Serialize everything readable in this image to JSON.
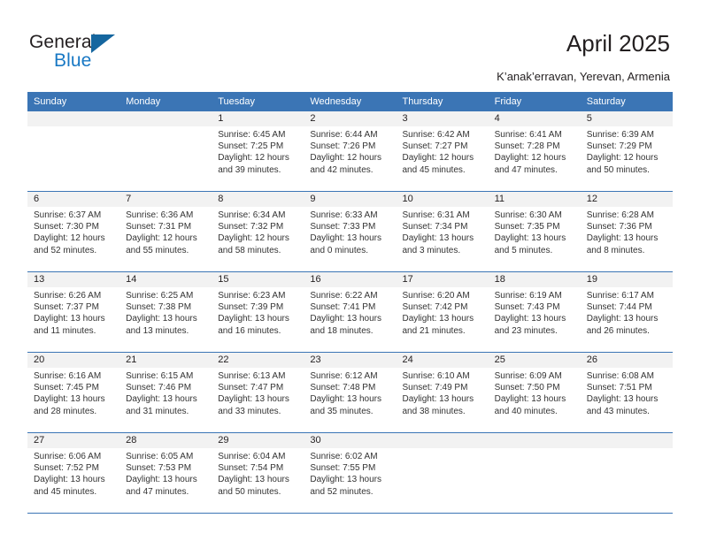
{
  "brand": {
    "name_part1": "General",
    "name_part2": "Blue"
  },
  "header": {
    "title": "April 2025",
    "location": "K’anak’erravan, Yerevan, Armenia"
  },
  "colors": {
    "header_blue": "#3b75b5",
    "brand_blue": "#1878c4",
    "row_band_gray": "#f2f2f2",
    "text": "#231f20"
  },
  "calendar": {
    "weekday_headers": [
      "Sunday",
      "Monday",
      "Tuesday",
      "Wednesday",
      "Thursday",
      "Friday",
      "Saturday"
    ],
    "weeks": [
      [
        {
          "day": "",
          "lines": []
        },
        {
          "day": "",
          "lines": []
        },
        {
          "day": "1",
          "lines": [
            "Sunrise: 6:45 AM",
            "Sunset: 7:25 PM",
            "Daylight: 12 hours",
            "and 39 minutes."
          ]
        },
        {
          "day": "2",
          "lines": [
            "Sunrise: 6:44 AM",
            "Sunset: 7:26 PM",
            "Daylight: 12 hours",
            "and 42 minutes."
          ]
        },
        {
          "day": "3",
          "lines": [
            "Sunrise: 6:42 AM",
            "Sunset: 7:27 PM",
            "Daylight: 12 hours",
            "and 45 minutes."
          ]
        },
        {
          "day": "4",
          "lines": [
            "Sunrise: 6:41 AM",
            "Sunset: 7:28 PM",
            "Daylight: 12 hours",
            "and 47 minutes."
          ]
        },
        {
          "day": "5",
          "lines": [
            "Sunrise: 6:39 AM",
            "Sunset: 7:29 PM",
            "Daylight: 12 hours",
            "and 50 minutes."
          ]
        }
      ],
      [
        {
          "day": "6",
          "lines": [
            "Sunrise: 6:37 AM",
            "Sunset: 7:30 PM",
            "Daylight: 12 hours",
            "and 52 minutes."
          ]
        },
        {
          "day": "7",
          "lines": [
            "Sunrise: 6:36 AM",
            "Sunset: 7:31 PM",
            "Daylight: 12 hours",
            "and 55 minutes."
          ]
        },
        {
          "day": "8",
          "lines": [
            "Sunrise: 6:34 AM",
            "Sunset: 7:32 PM",
            "Daylight: 12 hours",
            "and 58 minutes."
          ]
        },
        {
          "day": "9",
          "lines": [
            "Sunrise: 6:33 AM",
            "Sunset: 7:33 PM",
            "Daylight: 13 hours",
            "and 0 minutes."
          ]
        },
        {
          "day": "10",
          "lines": [
            "Sunrise: 6:31 AM",
            "Sunset: 7:34 PM",
            "Daylight: 13 hours",
            "and 3 minutes."
          ]
        },
        {
          "day": "11",
          "lines": [
            "Sunrise: 6:30 AM",
            "Sunset: 7:35 PM",
            "Daylight: 13 hours",
            "and 5 minutes."
          ]
        },
        {
          "day": "12",
          "lines": [
            "Sunrise: 6:28 AM",
            "Sunset: 7:36 PM",
            "Daylight: 13 hours",
            "and 8 minutes."
          ]
        }
      ],
      [
        {
          "day": "13",
          "lines": [
            "Sunrise: 6:26 AM",
            "Sunset: 7:37 PM",
            "Daylight: 13 hours",
            "and 11 minutes."
          ]
        },
        {
          "day": "14",
          "lines": [
            "Sunrise: 6:25 AM",
            "Sunset: 7:38 PM",
            "Daylight: 13 hours",
            "and 13 minutes."
          ]
        },
        {
          "day": "15",
          "lines": [
            "Sunrise: 6:23 AM",
            "Sunset: 7:39 PM",
            "Daylight: 13 hours",
            "and 16 minutes."
          ]
        },
        {
          "day": "16",
          "lines": [
            "Sunrise: 6:22 AM",
            "Sunset: 7:41 PM",
            "Daylight: 13 hours",
            "and 18 minutes."
          ]
        },
        {
          "day": "17",
          "lines": [
            "Sunrise: 6:20 AM",
            "Sunset: 7:42 PM",
            "Daylight: 13 hours",
            "and 21 minutes."
          ]
        },
        {
          "day": "18",
          "lines": [
            "Sunrise: 6:19 AM",
            "Sunset: 7:43 PM",
            "Daylight: 13 hours",
            "and 23 minutes."
          ]
        },
        {
          "day": "19",
          "lines": [
            "Sunrise: 6:17 AM",
            "Sunset: 7:44 PM",
            "Daylight: 13 hours",
            "and 26 minutes."
          ]
        }
      ],
      [
        {
          "day": "20",
          "lines": [
            "Sunrise: 6:16 AM",
            "Sunset: 7:45 PM",
            "Daylight: 13 hours",
            "and 28 minutes."
          ]
        },
        {
          "day": "21",
          "lines": [
            "Sunrise: 6:15 AM",
            "Sunset: 7:46 PM",
            "Daylight: 13 hours",
            "and 31 minutes."
          ]
        },
        {
          "day": "22",
          "lines": [
            "Sunrise: 6:13 AM",
            "Sunset: 7:47 PM",
            "Daylight: 13 hours",
            "and 33 minutes."
          ]
        },
        {
          "day": "23",
          "lines": [
            "Sunrise: 6:12 AM",
            "Sunset: 7:48 PM",
            "Daylight: 13 hours",
            "and 35 minutes."
          ]
        },
        {
          "day": "24",
          "lines": [
            "Sunrise: 6:10 AM",
            "Sunset: 7:49 PM",
            "Daylight: 13 hours",
            "and 38 minutes."
          ]
        },
        {
          "day": "25",
          "lines": [
            "Sunrise: 6:09 AM",
            "Sunset: 7:50 PM",
            "Daylight: 13 hours",
            "and 40 minutes."
          ]
        },
        {
          "day": "26",
          "lines": [
            "Sunrise: 6:08 AM",
            "Sunset: 7:51 PM",
            "Daylight: 13 hours",
            "and 43 minutes."
          ]
        }
      ],
      [
        {
          "day": "27",
          "lines": [
            "Sunrise: 6:06 AM",
            "Sunset: 7:52 PM",
            "Daylight: 13 hours",
            "and 45 minutes."
          ]
        },
        {
          "day": "28",
          "lines": [
            "Sunrise: 6:05 AM",
            "Sunset: 7:53 PM",
            "Daylight: 13 hours",
            "and 47 minutes."
          ]
        },
        {
          "day": "29",
          "lines": [
            "Sunrise: 6:04 AM",
            "Sunset: 7:54 PM",
            "Daylight: 13 hours",
            "and 50 minutes."
          ]
        },
        {
          "day": "30",
          "lines": [
            "Sunrise: 6:02 AM",
            "Sunset: 7:55 PM",
            "Daylight: 13 hours",
            "and 52 minutes."
          ]
        },
        {
          "day": "",
          "lines": []
        },
        {
          "day": "",
          "lines": []
        },
        {
          "day": "",
          "lines": []
        }
      ]
    ]
  }
}
